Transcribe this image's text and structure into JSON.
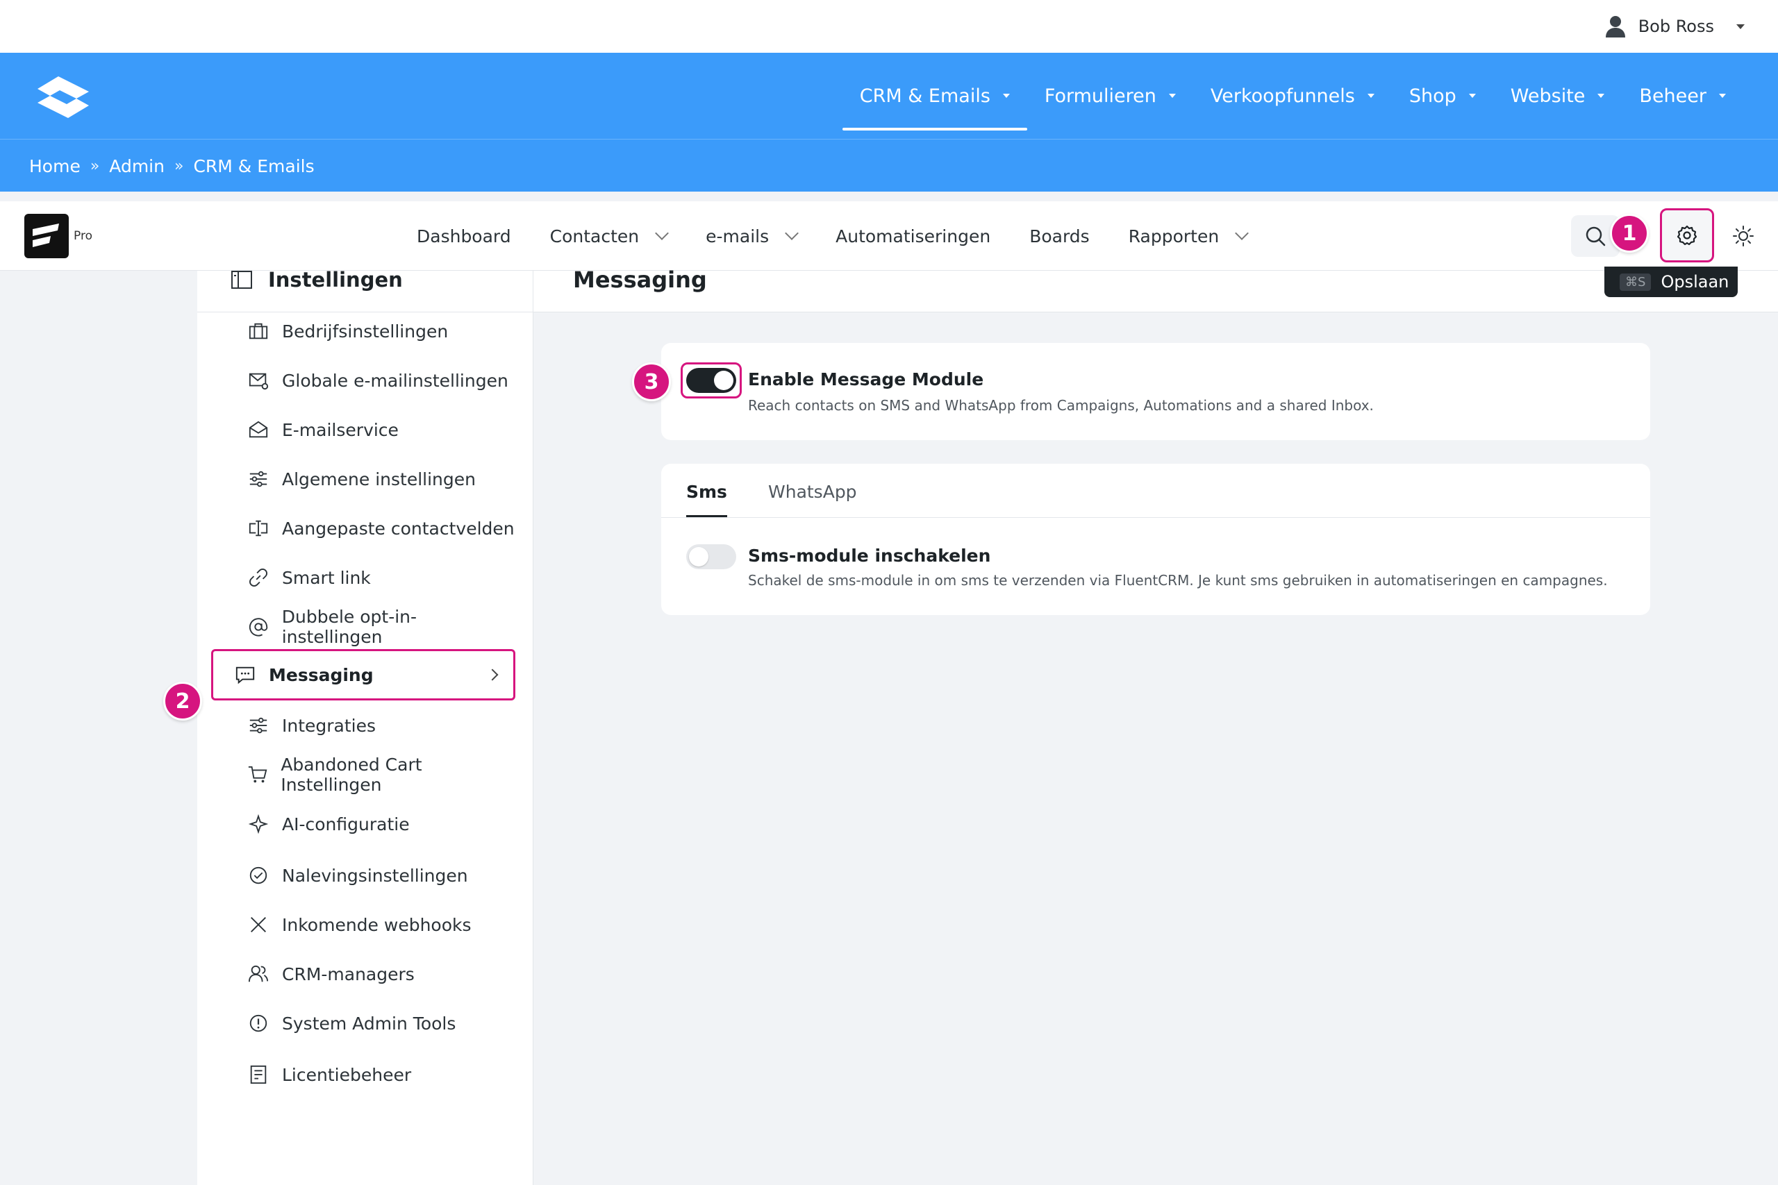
{
  "user": {
    "name": "Bob Ross"
  },
  "top_nav": {
    "items": [
      {
        "label": "CRM & Emails",
        "active": true
      },
      {
        "label": "Formulieren"
      },
      {
        "label": "Verkoopfunnels"
      },
      {
        "label": "Shop"
      },
      {
        "label": "Website"
      },
      {
        "label": "Beheer"
      }
    ]
  },
  "breadcrumb": {
    "items": [
      "Home",
      "Admin",
      "CRM & Emails"
    ],
    "separator": "»"
  },
  "app": {
    "badge": "Pro",
    "nav": [
      {
        "label": "Dashboard"
      },
      {
        "label": "Contacten"
      },
      {
        "label": "e-mails"
      },
      {
        "label": "Automatiseringen"
      },
      {
        "label": "Boards"
      },
      {
        "label": "Rapporten"
      }
    ]
  },
  "annotations": [
    "1",
    "2",
    "3"
  ],
  "sidebar": {
    "title": "Instellingen",
    "items": [
      {
        "label": "Bedrijfsinstellingen",
        "icon": "briefcase-icon"
      },
      {
        "label": "Globale e-mailinstellingen",
        "icon": "mail-settings-icon"
      },
      {
        "label": "E-mailservice",
        "icon": "mail-open-icon"
      },
      {
        "label": "Algemene instellingen",
        "icon": "sliders-icon"
      },
      {
        "label": "Aangepaste contactvelden",
        "icon": "text-field-icon"
      },
      {
        "label": "Smart link",
        "icon": "link-icon"
      },
      {
        "label": "Dubbele opt-in-instellingen",
        "icon": "at-icon"
      },
      {
        "label": "Messaging",
        "icon": "message-icon",
        "active": true
      },
      {
        "label": "Integraties",
        "icon": "sliders-icon"
      },
      {
        "label": "Abandoned Cart Instellingen",
        "icon": "cart-icon"
      },
      {
        "label": "AI-configuratie",
        "icon": "sparkle-icon"
      },
      {
        "label": "Nalevingsinstellingen",
        "icon": "check-circle-icon"
      },
      {
        "label": "Inkomende webhooks",
        "icon": "webhook-icon"
      },
      {
        "label": "CRM-managers",
        "icon": "users-icon"
      },
      {
        "label": "System Admin Tools",
        "icon": "alert-circle-icon"
      },
      {
        "label": "Licentiebeheer",
        "icon": "license-icon"
      }
    ]
  },
  "main": {
    "title": "Messaging",
    "save": {
      "shortcut": "⌘S",
      "label": "Opslaan"
    },
    "module": {
      "title": "Enable Message Module",
      "description": "Reach contacts on SMS and WhatsApp from Campaigns, Automations and a shared Inbox.",
      "enabled": true
    },
    "tabs": [
      {
        "label": "Sms",
        "active": true
      },
      {
        "label": "WhatsApp"
      }
    ],
    "sms": {
      "title": "Sms-module inschakelen",
      "description": "Schakel de sms-module in om sms te verzenden via FluentCRM. Je kunt sms gebruiken in automatiseringen en campagnes.",
      "enabled": false
    }
  },
  "colors": {
    "brand_blue": "#3b9bfa",
    "highlight": "#d6157f",
    "dark": "#1d2327"
  }
}
